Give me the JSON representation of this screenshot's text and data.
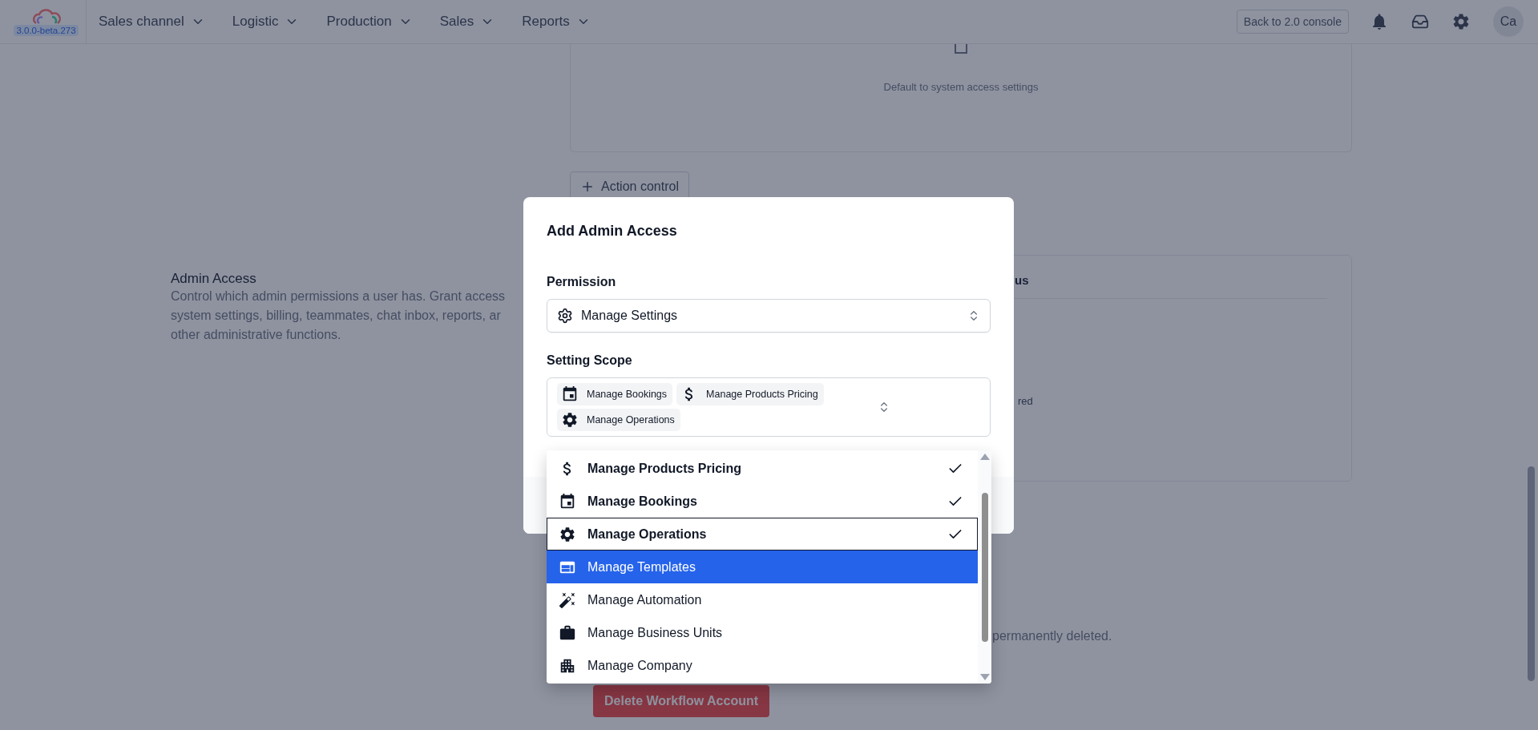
{
  "nav": {
    "version": "3.0.0-beta.273",
    "menus": [
      "Sales channel",
      "Logistic",
      "Production",
      "Sales",
      "Reports"
    ],
    "back_button": "Back to 2.0 console",
    "avatar": "Ca"
  },
  "background": {
    "access_card": {
      "text": "Default to system access settings"
    },
    "action_button": "Action control",
    "admin_access": {
      "title": "Admin Access",
      "description_lines": [
        "Control which admin permissions a user has. Grant access",
        "system settings, billing, teammates, chat inbox, reports, ar",
        "other administrative functions."
      ]
    },
    "status_card": {
      "heading_fragment": "us",
      "text_fragment": "red"
    },
    "delete_section": {
      "text_fragment": "permanently deleted.",
      "button": "Delete Workflow Account"
    }
  },
  "modal": {
    "title": "Add Admin Access",
    "permission": {
      "label": "Permission",
      "value": "Manage Settings"
    },
    "scope": {
      "label": "Setting Scope",
      "chips": [
        "Manage Bookings",
        "Manage Products Pricing",
        "Manage Operations"
      ]
    },
    "options": [
      {
        "label": "Manage Products Pricing",
        "selected": true,
        "highlighted": false,
        "focused": false
      },
      {
        "label": "Manage Bookings",
        "selected": true,
        "highlighted": false,
        "focused": false
      },
      {
        "label": "Manage Operations",
        "selected": true,
        "highlighted": false,
        "focused": true
      },
      {
        "label": "Manage Templates",
        "selected": false,
        "highlighted": true,
        "focused": false
      },
      {
        "label": "Manage Automation",
        "selected": false,
        "highlighted": false,
        "focused": false
      },
      {
        "label": "Manage Business Units",
        "selected": false,
        "highlighted": false,
        "focused": false
      },
      {
        "label": "Manage Company",
        "selected": false,
        "highlighted": false,
        "focused": false
      }
    ]
  }
}
